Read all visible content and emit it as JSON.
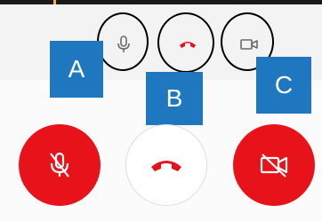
{
  "annotation_labels": {
    "a": "A",
    "b": "B",
    "c": "C"
  },
  "colors": {
    "accent_red": "#e8131a",
    "label_blue": "#1f78bf",
    "highlight_yellow": "#f2b33d",
    "icon_gray": "#6b6b6b"
  },
  "mini_controls": [
    {
      "name": "mic-icon"
    },
    {
      "name": "hang-up-icon"
    },
    {
      "name": "video-icon"
    }
  ],
  "main_controls": [
    {
      "name": "mute-button",
      "state": "muted"
    },
    {
      "name": "hang-up-button"
    },
    {
      "name": "video-off-button",
      "state": "off"
    }
  ]
}
